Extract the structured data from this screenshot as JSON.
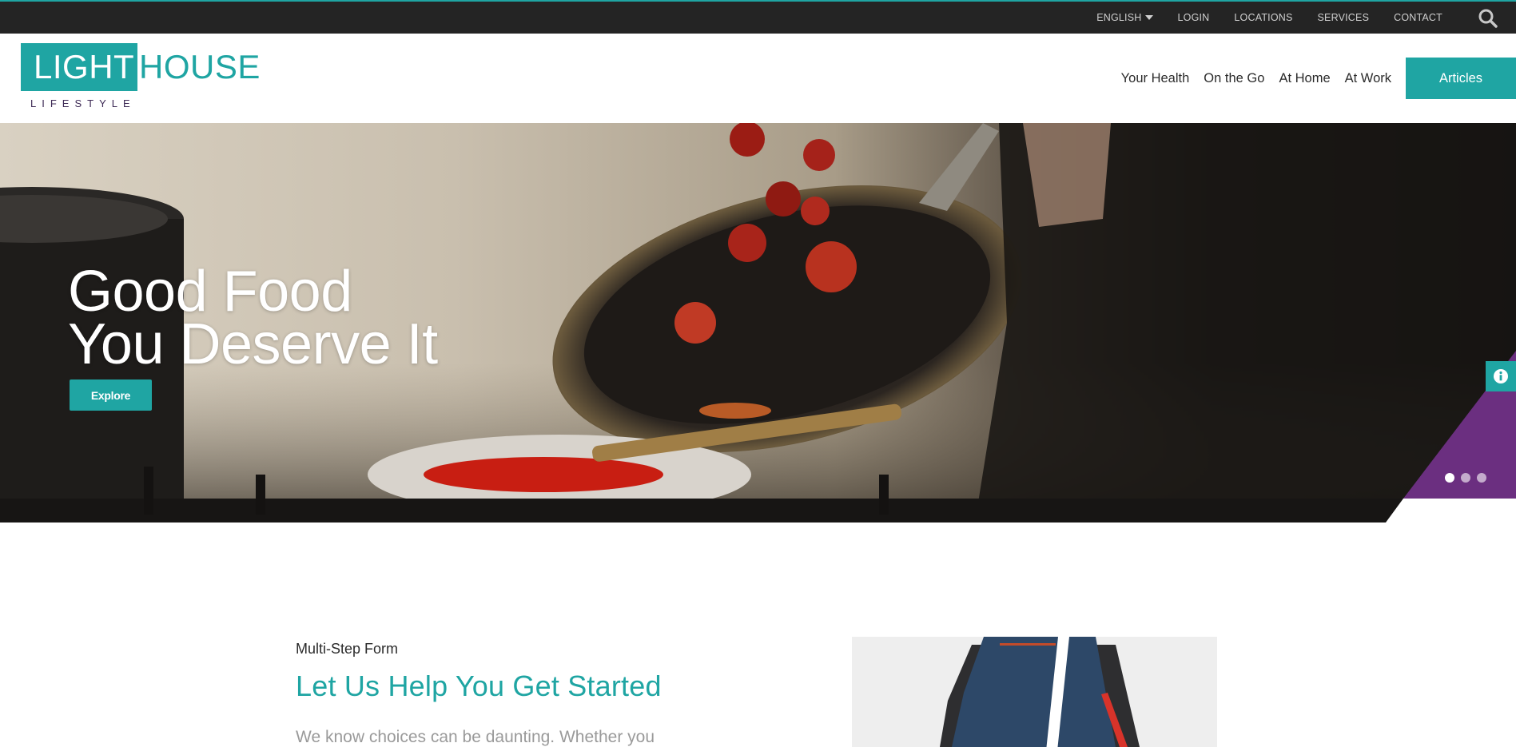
{
  "topbar": {
    "language": "ENGLISH",
    "links": [
      "LOGIN",
      "LOCATIONS",
      "SERVICES",
      "CONTACT"
    ]
  },
  "logo": {
    "part1": "LIGHT",
    "part2": "HOUSE",
    "sub": "LIFESTYLE"
  },
  "nav": {
    "items": [
      "Your Health",
      "On the Go",
      "At Home",
      "At Work"
    ],
    "cta": "Articles"
  },
  "hero": {
    "title_line1": "Good Food",
    "title_line2": "You Deserve It",
    "button": "Explore",
    "slides": 3,
    "active_slide": 1
  },
  "section": {
    "eyebrow": "Multi-Step Form",
    "title": "Let Us Help You Get Started",
    "body": "We know choices can be daunting. Whether you"
  },
  "colors": {
    "accent": "#1fa5a3",
    "purple": "#6b2f80",
    "topbar": "#242424"
  },
  "icons": [
    "search-icon",
    "caret-down-icon",
    "info-icon"
  ]
}
